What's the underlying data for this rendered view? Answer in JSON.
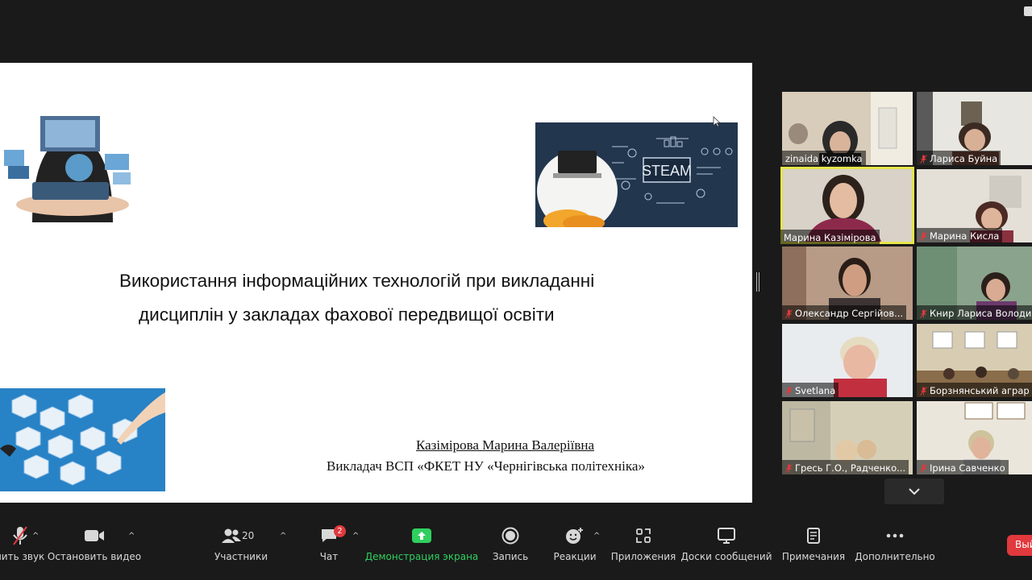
{
  "slide": {
    "title_line1": "Використання інформаційних технологій при викладанні",
    "title_line2": "дисциплін у закладах фахової передвищої освіти",
    "author_name": "Казімірова Марина Валеріївна",
    "author_role": "Викладач ВСП «ФКЕТ НУ «Чернігівська політехніка»",
    "steam_label": "STEAM"
  },
  "participants": [
    {
      "name": "zinaida kyzomka",
      "muted": false
    },
    {
      "name": "Лариса Буйна",
      "muted": true
    },
    {
      "name": "Марина Казімірова",
      "muted": false,
      "active": true
    },
    {
      "name": "Марина Кисла",
      "muted": true
    },
    {
      "name": "Олександр Сергійов...",
      "muted": true
    },
    {
      "name": "Книр Лариса Володи",
      "muted": true
    },
    {
      "name": "Svetlana",
      "muted": true
    },
    {
      "name": "Борзнянський аграр",
      "muted": true
    },
    {
      "name": "Гресь Г.О., Радченко...",
      "muted": true
    },
    {
      "name": "Ірина Савченко",
      "muted": true
    }
  ],
  "toolbar": {
    "mute_label": "чить звук",
    "video_label": "Остановить видео",
    "participants_label": "Участники",
    "participants_count": "20",
    "chat_label": "Чат",
    "chat_badge": "2",
    "share_label": "Демонстрация экрана",
    "record_label": "Запись",
    "reactions_label": "Реакции",
    "apps_label": "Приложения",
    "whiteboard_label": "Доски сообщений",
    "notes_label": "Примечания",
    "more_label": "Дополнительно",
    "end_label": "Вый"
  },
  "colors": {
    "background": "#1a1a1a",
    "share_green": "#2fd05e",
    "active_speaker": "#e5e54b",
    "badge_red": "#e0393e"
  }
}
